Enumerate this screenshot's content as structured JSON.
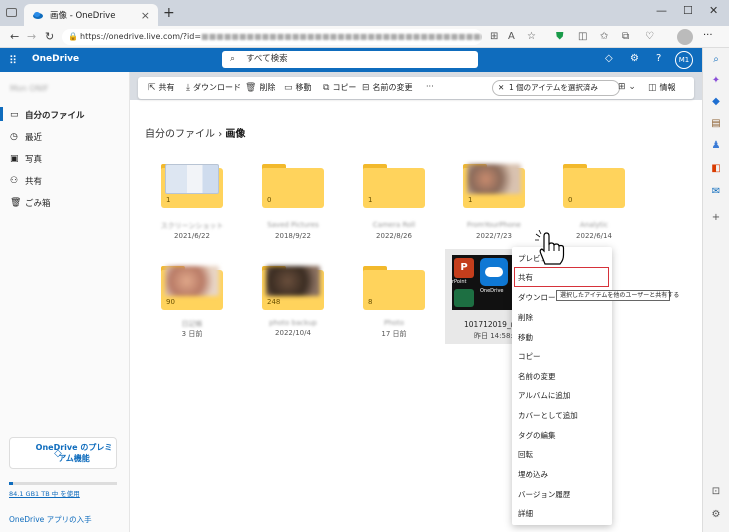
{
  "browser": {
    "tab_title": "画像 - OneDrive",
    "tab_close": "×",
    "new_tab": "+",
    "win_min": "—",
    "win_max": "☐",
    "win_close": "✕",
    "url_visible": "https://onedrive.live.com/?id=",
    "url_rest": "■■■■■■■■■■■■■■■■■■■■■■■■■■■■■■■■■■■■■■■■■",
    "back": "←",
    "forward": "→",
    "reload": "↻",
    "home": "⌂",
    "more": "···"
  },
  "header": {
    "app_name": "OneDrive",
    "search_placeholder": "すべて検索",
    "avatar": "M1",
    "help": "?"
  },
  "leftnav": {
    "user": "Mon ONIF",
    "items": [
      {
        "label": "自分のファイル",
        "icon": "▭"
      },
      {
        "label": "最近",
        "icon": "◷"
      },
      {
        "label": "写真",
        "icon": "▣"
      },
      {
        "label": "共有",
        "icon": "⚇"
      },
      {
        "label": "ごみ箱",
        "icon": "🗑"
      }
    ],
    "premium": "OneDrive のプレミアム機能",
    "storage": "84.1 GB1 TB 中 を使用",
    "get_apps": "OneDrive アプリの入手"
  },
  "commandbar": {
    "share": "共有",
    "download": "ダウンロード",
    "delete": "削除",
    "move": "移動",
    "copy": "コピー",
    "rename": "名前の変更",
    "more": "···",
    "selection": "1 個のアイテムを選択済み",
    "info": "情報"
  },
  "breadcrumb": {
    "root": "自分のファイル",
    "sep": "›",
    "current": "画像"
  },
  "folders": [
    {
      "count": "1",
      "name": "スクリーンショット",
      "date": "2021/6/22"
    },
    {
      "count": "0",
      "name": "Saved Pictures",
      "date": "2018/9/22"
    },
    {
      "count": "1",
      "name": "Camera Roll",
      "date": "2022/8/26"
    },
    {
      "count": "1",
      "name": "FromYourPhone",
      "date": "2022/7/23"
    },
    {
      "count": "0",
      "name": "Analytic",
      "date": "2022/6/14"
    },
    {
      "count": "90",
      "name": "日記帳",
      "date": "3 日前"
    },
    {
      "count": "248",
      "name": "photo backup",
      "date": "2022/10/4"
    },
    {
      "count": "8",
      "name": "Photo",
      "date": "17 日前"
    }
  ],
  "photo": {
    "name": "101712019_m...",
    "date": "昨日 14:58:42",
    "ppt_letter": "P",
    "label_point": "rPoint",
    "label_od": "OneDrive"
  },
  "context_menu": {
    "items": [
      "プレビュー",
      "共有",
      "ダウンロード",
      "削除",
      "移動",
      "コピー",
      "名前の変更",
      "アルバムに追加",
      "カバーとして追加",
      "タグの編集",
      "回転",
      "埋め込み",
      "バージョン履歴",
      "詳細"
    ],
    "tooltip": "選択したアイテムを他のユーザーと共有する"
  },
  "colors": {
    "brand": "#0f6cbd",
    "folder": "#ffd35c",
    "highlight": "#d6323a"
  }
}
